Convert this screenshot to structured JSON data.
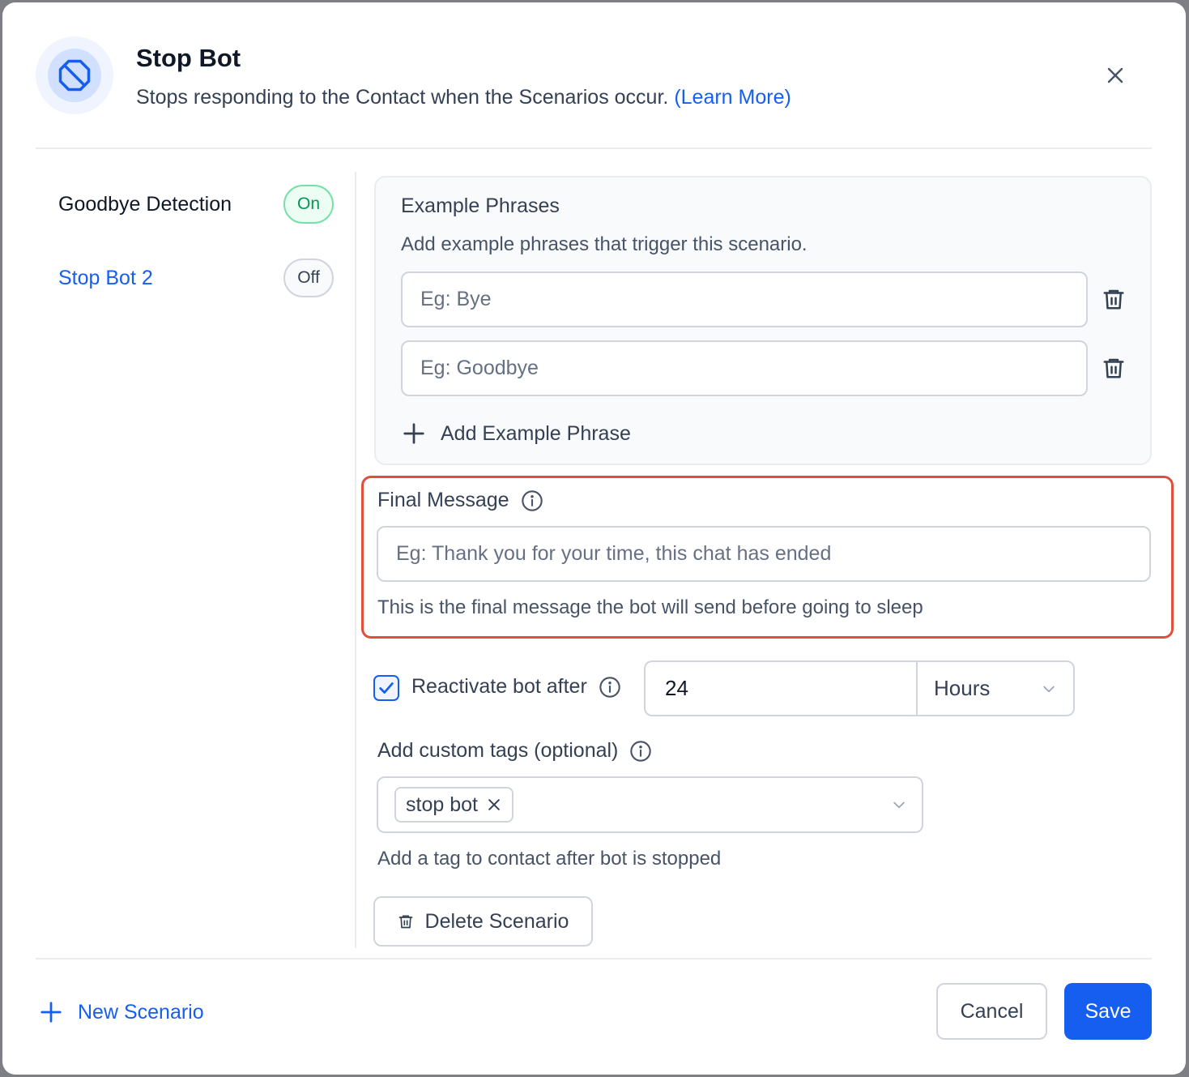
{
  "header": {
    "title": "Stop Bot",
    "subtitle": "Stops responding to the Contact when the Scenarios occur.",
    "learn_more": "(Learn More)"
  },
  "sidebar": {
    "scenarios": [
      {
        "name": "Goodbye Detection",
        "status": "On",
        "active": false
      },
      {
        "name": "Stop Bot 2",
        "status": "Off",
        "active": true
      }
    ]
  },
  "example_phrases": {
    "title": "Example Phrases",
    "subtitle": "Add example phrases that trigger this scenario.",
    "inputs": [
      {
        "value": "",
        "placeholder": "Eg: Bye"
      },
      {
        "value": "",
        "placeholder": "Eg: Goodbye"
      }
    ],
    "add_label": "Add Example Phrase"
  },
  "final_message": {
    "label": "Final Message",
    "placeholder": "Eg: Thank you for your time, this chat has ended",
    "value": "",
    "help": "This is the final message the bot will send before going to sleep"
  },
  "reactivate": {
    "checked": true,
    "label": "Reactivate bot after",
    "value": "24",
    "unit": "Hours"
  },
  "tags": {
    "label": "Add custom tags (optional)",
    "selected": [
      "stop bot"
    ],
    "help": "Add a tag to contact after bot is stopped"
  },
  "delete_label": "Delete Scenario",
  "footer": {
    "new_scenario": "New Scenario",
    "cancel": "Cancel",
    "save": "Save"
  },
  "colors": {
    "primary": "#155eef",
    "highlight_border": "#e04f3c",
    "on_green": "#079455"
  },
  "icons": [
    "stop-icon",
    "close-icon",
    "trash-icon",
    "plus-icon",
    "info-icon",
    "check-icon",
    "chevron-down-icon",
    "x-icon"
  ]
}
